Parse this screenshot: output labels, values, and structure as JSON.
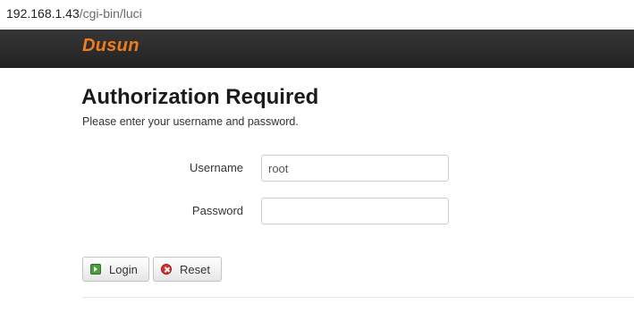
{
  "browser": {
    "url_host": "192.168.1.43",
    "url_path": "/cgi-bin/luci"
  },
  "header": {
    "brand": "Dusun"
  },
  "main": {
    "title": "Authorization Required",
    "subtitle": "Please enter your username and password.",
    "username_label": "Username",
    "username_value": "root",
    "password_label": "Password",
    "password_value": "",
    "login_label": "Login",
    "reset_label": "Reset"
  },
  "colors": {
    "brand": "#f07d1a",
    "header_bg": "#2b2b2b",
    "login_icon": "#4b9e3c",
    "reset_icon": "#d93030"
  },
  "icons": {
    "login": "login-icon",
    "reset": "reset-icon"
  }
}
